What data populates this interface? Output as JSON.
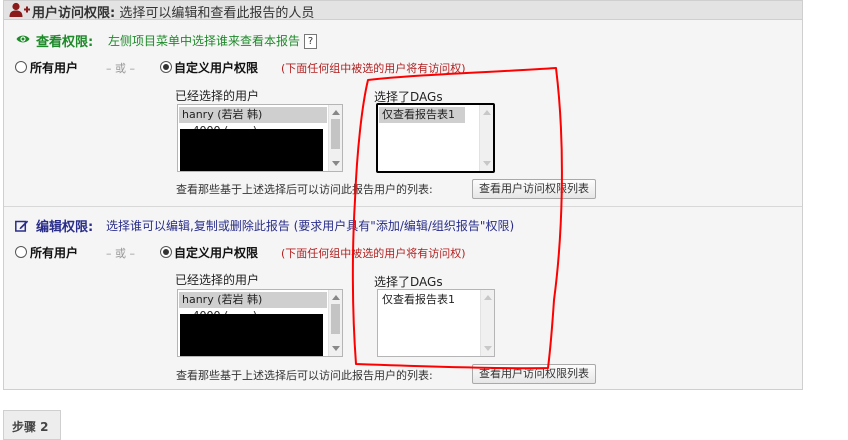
{
  "header": {
    "icon": "user-add-icon",
    "title_bold": "用户访问权限:",
    "title_rest": " 选择可以编辑和查看此报告的人员"
  },
  "view_section": {
    "icon": "eye-icon",
    "title": "查看权限:",
    "description": "左侧项目菜单中选择谁来查看本报告",
    "help_label": "?",
    "option_all_label": "所有用户",
    "or_text": "– 或 –",
    "option_custom_label": "自定义用户权限",
    "note": "(下面任何组中被选的用户将有访问权)",
    "selected_users_label": "已经选择的用户",
    "selected_users": [
      "hanry (若岩 韩)",
      "...4000 (.......)"
    ],
    "selected_dags_label": "选择了DAGs",
    "selected_dags": [
      "仅查看报告表1"
    ],
    "footer_text": "查看那些基于上述选择后可以访问此报告用户的列表:",
    "list_button_label": "查看用户访问权限列表"
  },
  "edit_section": {
    "icon": "edit-icon",
    "title": "编辑权限:",
    "description": "选择谁可以编辑,复制或删除此报告 (要求用户具有\"添加/编辑/组织报告\"权限)",
    "option_all_label": "所有用户",
    "or_text": "– 或 –",
    "option_custom_label": "自定义用户权限",
    "note": "(下面任何组中被选的用户将有访问权)",
    "selected_users_label": "已经选择的用户",
    "selected_users": [
      "hanry (若岩 韩)",
      "...4000 (.......)"
    ],
    "selected_dags_label": "选择了DAGs",
    "selected_dags": [
      "仅查看报告表1"
    ],
    "footer_text": "查看那些基于上述选择后可以访问此报告用户的列表:",
    "list_button_label": "查看用户访问权限列表"
  },
  "footer": {
    "next_step_label": "步骤 2"
  },
  "colors": {
    "view_green": "#1e8a2a",
    "edit_blue": "#2a2e8a",
    "note_red": "#b22222",
    "annotation_red": "#ff0000"
  }
}
